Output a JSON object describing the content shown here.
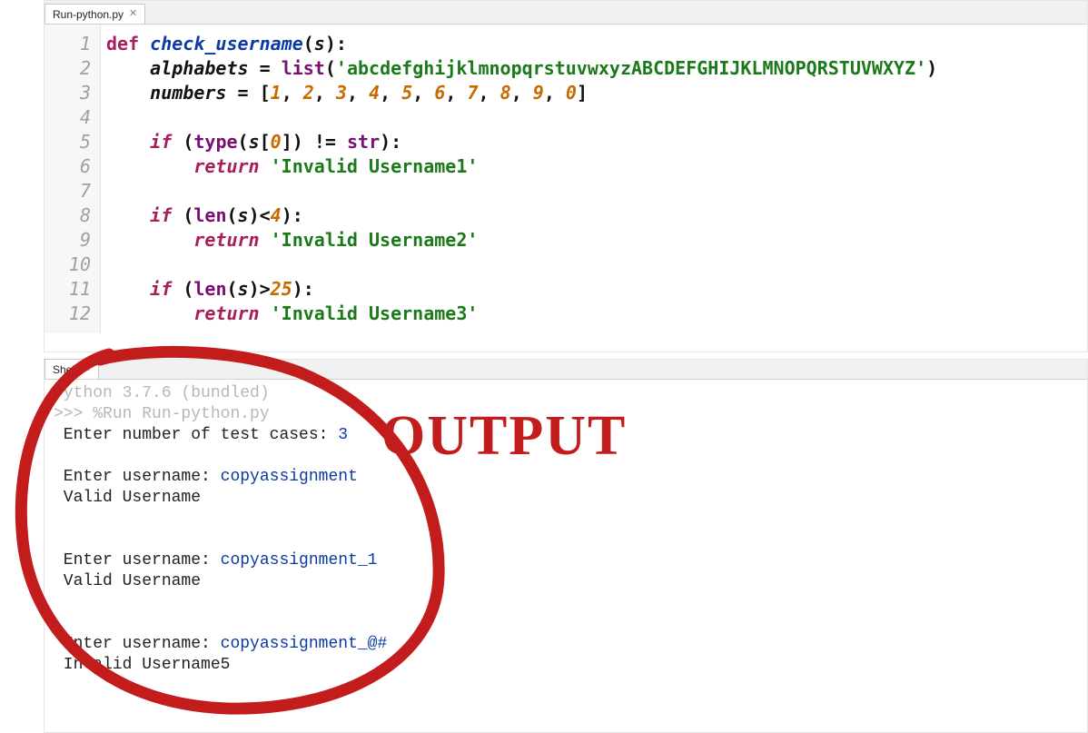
{
  "editor": {
    "tab": {
      "label": "Run-python.py"
    },
    "lines": [
      "1",
      "2",
      "3",
      "4",
      "5",
      "6",
      "7",
      "8",
      "9",
      "10",
      "11",
      "12"
    ],
    "code": {
      "l1_def": "def",
      "l1_fn": "check_username",
      "l1_s": "s",
      "l2_var": "alphabets",
      "l2_list": "list",
      "l2_str": "'abcdefghijklmnopqrstuvwxyzABCDEFGHIJKLMNOPQRSTUVWXYZ'",
      "l3_var": "numbers",
      "l3_n1": "1",
      "l3_n2": "2",
      "l3_n3": "3",
      "l3_n4": "4",
      "l3_n5": "5",
      "l3_n6": "6",
      "l3_n7": "7",
      "l3_n8": "8",
      "l3_n9": "9",
      "l3_n0": "0",
      "if": "if",
      "l5_type": "type",
      "l5_s": "s",
      "l5_zero": "0",
      "l5_str": "str",
      "return": "return",
      "l6_str": "'Invalid Username1'",
      "l8_len": "len",
      "l8_s": "s",
      "l8_num": "4",
      "l9_str": "'Invalid Username2'",
      "l11_len": "len",
      "l11_s": "s",
      "l11_num": "25",
      "l12_str": "'Invalid Username3'"
    }
  },
  "shell": {
    "tab": {
      "label": "Shell"
    },
    "banner": "Python 3.7.6 (bundled)",
    "prompt": ">>> ",
    "run_cmd": "%Run Run-python.py",
    "p_cases": " Enter number of test cases: ",
    "v_cases": "3",
    "p_user": " Enter username: ",
    "u1": "copyassignment",
    "r1": " Valid Username",
    "u2": "copyassignment_1",
    "r2": " Valid Username",
    "u3": "copyassignment_@#",
    "r3": " Invalid Username5"
  },
  "annotation": {
    "text": "OUTPUT"
  }
}
